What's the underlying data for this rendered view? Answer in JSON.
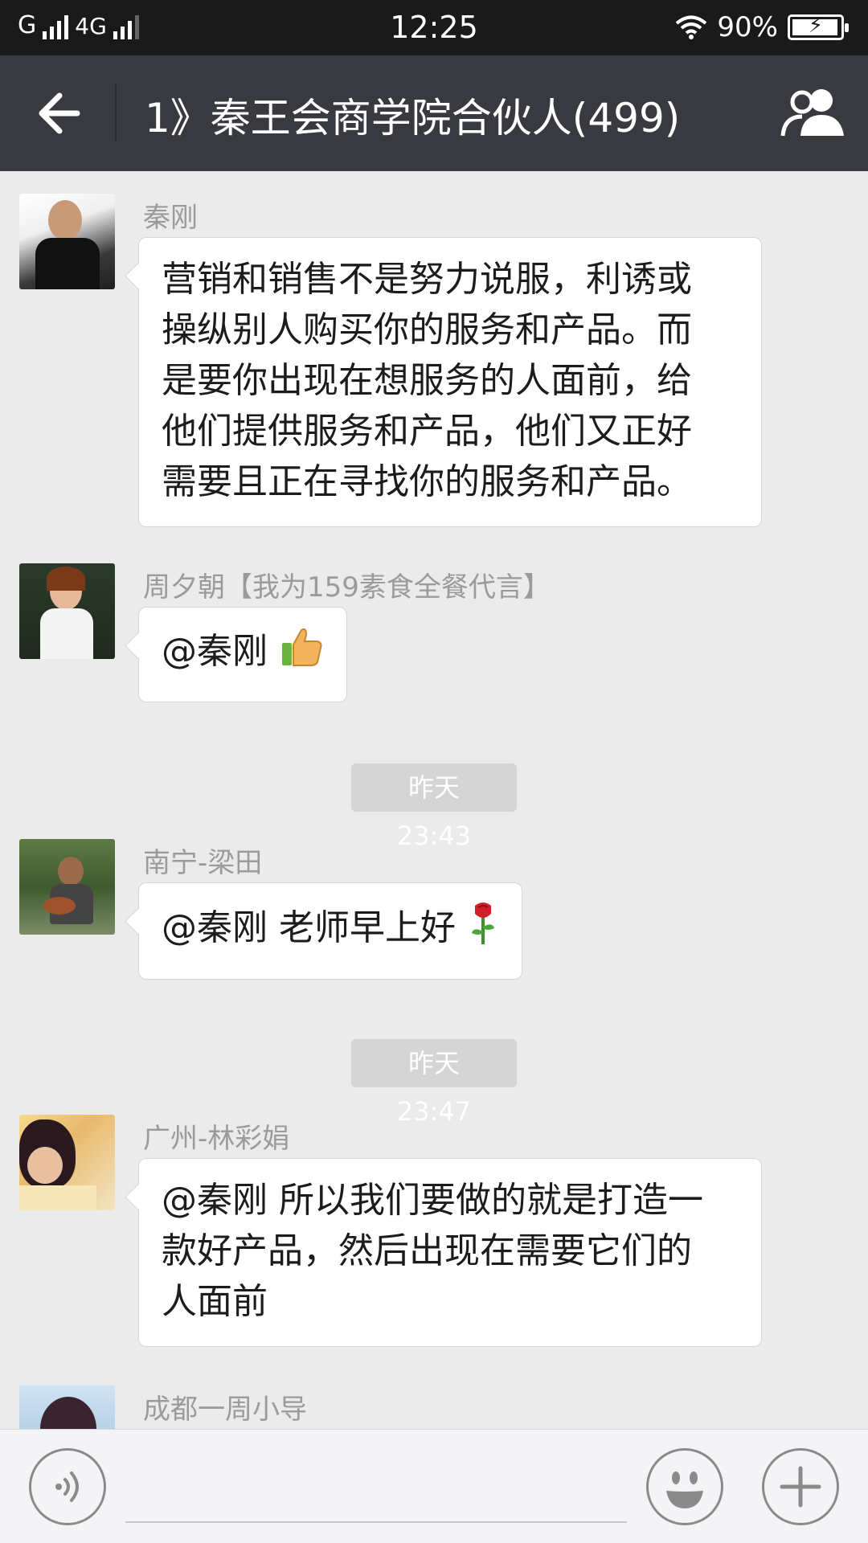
{
  "status": {
    "carrier": "G",
    "network": "4G",
    "time": "12:25",
    "battery": "90%"
  },
  "header": {
    "title": "1》秦王会商学院合伙人(499)",
    "back_icon": "arrow-left-icon",
    "group_icon": "group-members-icon"
  },
  "messages": [
    {
      "sender": "秦刚",
      "lines": [
        "营销和销售不是努力说服，利诱或",
        "操纵别人购买你的服务和产品。而",
        "是要你出现在想服务的人面前，给",
        "他们提供服务和产品，他们又正好",
        "需要且正在寻找你的服务和产品。"
      ]
    },
    {
      "sender": "周夕朝【我为159素食全餐代言】",
      "text": "@秦刚",
      "emoji": "thumbs-up-icon"
    },
    {
      "timestamp": "昨天 23:43"
    },
    {
      "sender": "南宁-梁田",
      "text": "@秦刚 老师早上好",
      "emoji": "rose-icon"
    },
    {
      "timestamp": "昨天 23:47"
    },
    {
      "sender": "广州-林彩娟",
      "lines": [
        "@秦刚 所以我们要做的就是打造一",
        "款好产品，然后出现在需要它们的",
        "人面前"
      ]
    },
    {
      "sender": "成都一周小导"
    }
  ],
  "input": {
    "voice_icon": "voice-icon",
    "emoji_icon": "smiley-icon",
    "plus_icon": "plus-icon"
  }
}
